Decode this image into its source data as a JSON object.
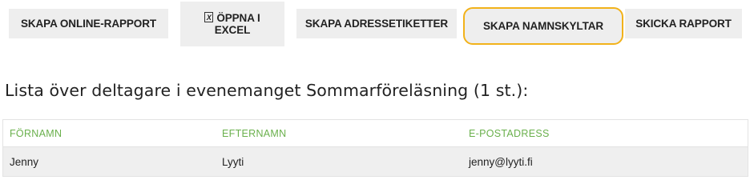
{
  "toolbar": {
    "online_report_label": "SKAPA ONLINE-RAPPORT",
    "excel_line1": "ÖPPNA I",
    "excel_line2": "EXCEL",
    "excel_icon_glyph": "x",
    "address_labels_label": "SKAPA ADRESSETIKETTER",
    "name_tags_label": "SKAPA NAMNSKYLTAR",
    "send_report_label": "SKICKA RAPPORT"
  },
  "heading": "Lista över deltagare i evenemanget Sommarföreläsning (1 st.):",
  "table": {
    "columns": [
      "FÖRNAMN",
      "EFTERNAMN",
      "E-POSTADRESS"
    ],
    "rows": [
      [
        "Jenny",
        "Lyyti",
        "jenny@lyyti.fi"
      ]
    ]
  },
  "colors": {
    "button_bg": "#eeeeee",
    "highlight_border": "#f2b21a",
    "column_header": "#6ab04c",
    "row_bg": "#efefef"
  },
  "icons": {
    "excel": "excel-file-icon"
  }
}
